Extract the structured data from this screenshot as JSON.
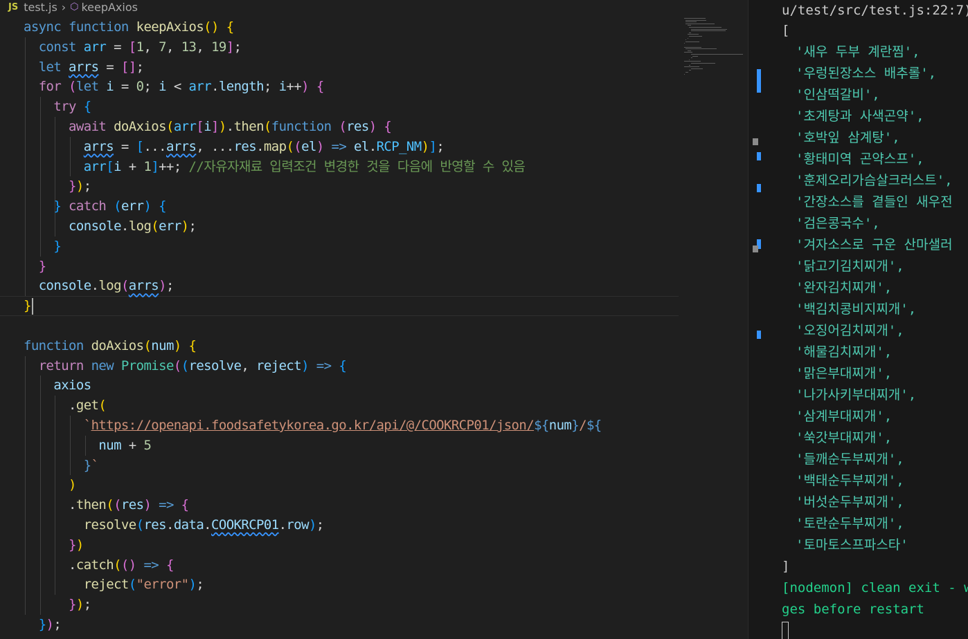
{
  "breadcrumb": {
    "lang_badge": "JS",
    "file": "test.js",
    "symbol": "keepAxios"
  },
  "icons": {
    "breadcrumb_separator": "chevron-right-icon",
    "symbol_icon": "cube-icon"
  },
  "colors": {
    "editor_bg": "#1f1f1f",
    "terminal_bg": "#181818",
    "keyword": "#569cd6",
    "control": "#c586c0",
    "function": "#dcdcaa",
    "variable": "#9cdcfe",
    "string": "#ce9178",
    "comment": "#6a9955",
    "terminal_string": "#4ec9b0",
    "terminal_status": "#23d18b"
  },
  "code": {
    "lines": [
      [
        [
          "kw",
          "async "
        ],
        [
          "kw",
          "function "
        ],
        [
          "fn",
          "keepAxios"
        ],
        [
          "b1",
          "()"
        ],
        [
          "pun",
          " "
        ],
        [
          "b1",
          "{"
        ]
      ],
      [
        [
          "pun",
          "  "
        ],
        [
          "kw",
          "const "
        ],
        [
          "cst",
          "arr"
        ],
        [
          "pun",
          " = "
        ],
        [
          "b2",
          "["
        ],
        [
          "num",
          "1"
        ],
        [
          "pun",
          ", "
        ],
        [
          "num",
          "7"
        ],
        [
          "pun",
          ", "
        ],
        [
          "num",
          "13"
        ],
        [
          "pun",
          ", "
        ],
        [
          "num",
          "19"
        ],
        [
          "b2",
          "]"
        ],
        [
          "pun",
          ";"
        ]
      ],
      [
        [
          "pun",
          "  "
        ],
        [
          "kw",
          "let "
        ],
        [
          "var squig",
          "arrs"
        ],
        [
          "pun",
          " = "
        ],
        [
          "b2",
          "[]"
        ],
        [
          "pun",
          ";"
        ]
      ],
      [
        [
          "pun",
          "  "
        ],
        [
          "ctl",
          "for "
        ],
        [
          "b2",
          "("
        ],
        [
          "kw",
          "let "
        ],
        [
          "var",
          "i"
        ],
        [
          "pun",
          " = "
        ],
        [
          "num",
          "0"
        ],
        [
          "pun",
          "; "
        ],
        [
          "var",
          "i"
        ],
        [
          "pun",
          " < "
        ],
        [
          "cst",
          "arr"
        ],
        [
          "pun",
          "."
        ],
        [
          "var",
          "length"
        ],
        [
          "pun",
          "; "
        ],
        [
          "var",
          "i"
        ],
        [
          "pun",
          "++"
        ],
        [
          "b2",
          ")"
        ],
        [
          "pun",
          " "
        ],
        [
          "b2",
          "{"
        ]
      ],
      [
        [
          "pun",
          "    "
        ],
        [
          "ctl",
          "try "
        ],
        [
          "b3",
          "{"
        ]
      ],
      [
        [
          "pun",
          "      "
        ],
        [
          "ctl",
          "await "
        ],
        [
          "fn",
          "doAxios"
        ],
        [
          "b1",
          "("
        ],
        [
          "cst",
          "arr"
        ],
        [
          "b2",
          "["
        ],
        [
          "var",
          "i"
        ],
        [
          "b2",
          "]"
        ],
        [
          "b1",
          ")"
        ],
        [
          "pun",
          "."
        ],
        [
          "fn",
          "then"
        ],
        [
          "b1",
          "("
        ],
        [
          "kw",
          "function "
        ],
        [
          "b2",
          "("
        ],
        [
          "var",
          "res"
        ],
        [
          "b2",
          ")"
        ],
        [
          "pun",
          " "
        ],
        [
          "b2",
          "{"
        ]
      ],
      [
        [
          "pun",
          "        "
        ],
        [
          "var squig",
          "arrs"
        ],
        [
          "pun",
          " = "
        ],
        [
          "b3",
          "["
        ],
        [
          "pun",
          "..."
        ],
        [
          "var squig",
          "arrs"
        ],
        [
          "pun",
          ", ..."
        ],
        [
          "var",
          "res"
        ],
        [
          "pun",
          "."
        ],
        [
          "fn",
          "map"
        ],
        [
          "b1",
          "("
        ],
        [
          "b2",
          "("
        ],
        [
          "var",
          "el"
        ],
        [
          "b2",
          ")"
        ],
        [
          "pun",
          " "
        ],
        [
          "kw",
          "=>"
        ],
        [
          "pun",
          " "
        ],
        [
          "var",
          "el"
        ],
        [
          "pun",
          "."
        ],
        [
          "cst",
          "RCP_NM"
        ],
        [
          "b1",
          ")"
        ],
        [
          "b3",
          "]"
        ],
        [
          "pun",
          ";"
        ]
      ],
      [
        [
          "pun",
          "        "
        ],
        [
          "cst",
          "arr"
        ],
        [
          "b3",
          "["
        ],
        [
          "var",
          "i"
        ],
        [
          "pun",
          " + "
        ],
        [
          "num",
          "1"
        ],
        [
          "b3",
          "]"
        ],
        [
          "pun",
          "++; "
        ],
        [
          "cmt",
          "//자유자재료 입력조건 변경한 것을 다음에 반영할 수 있음"
        ]
      ],
      [
        [
          "pun",
          "      "
        ],
        [
          "b2",
          "}"
        ],
        [
          "b1",
          ")"
        ],
        [
          "pun",
          ";"
        ]
      ],
      [
        [
          "pun",
          "    "
        ],
        [
          "b3",
          "}"
        ],
        [
          "pun",
          " "
        ],
        [
          "ctl",
          "catch "
        ],
        [
          "b3",
          "("
        ],
        [
          "var",
          "err"
        ],
        [
          "b3",
          ")"
        ],
        [
          "pun",
          " "
        ],
        [
          "b3",
          "{"
        ]
      ],
      [
        [
          "pun",
          "      "
        ],
        [
          "var",
          "console"
        ],
        [
          "pun",
          "."
        ],
        [
          "fn",
          "log"
        ],
        [
          "b1",
          "("
        ],
        [
          "var",
          "err"
        ],
        [
          "b1",
          ")"
        ],
        [
          "pun",
          ";"
        ]
      ],
      [
        [
          "pun",
          "    "
        ],
        [
          "b3",
          "}"
        ]
      ],
      [
        [
          "pun",
          "  "
        ],
        [
          "b2",
          "}"
        ]
      ],
      [
        [
          "pun",
          "  "
        ],
        [
          "var",
          "console"
        ],
        [
          "pun",
          "."
        ],
        [
          "fn",
          "log"
        ],
        [
          "b2",
          "("
        ],
        [
          "var squig",
          "arrs"
        ],
        [
          "b2",
          ")"
        ],
        [
          "pun",
          ";"
        ]
      ],
      [
        [
          "b1",
          "}"
        ]
      ],
      [],
      [
        [
          "kw",
          "function "
        ],
        [
          "fn",
          "doAxios"
        ],
        [
          "b1",
          "("
        ],
        [
          "var",
          "num"
        ],
        [
          "b1",
          ")"
        ],
        [
          "pun",
          " "
        ],
        [
          "b1",
          "{"
        ]
      ],
      [
        [
          "pun",
          "  "
        ],
        [
          "ctl",
          "return "
        ],
        [
          "kw",
          "new "
        ],
        [
          "typ",
          "Promise"
        ],
        [
          "b2",
          "("
        ],
        [
          "b3",
          "("
        ],
        [
          "var",
          "resolve"
        ],
        [
          "pun",
          ", "
        ],
        [
          "var",
          "reject"
        ],
        [
          "b3",
          ")"
        ],
        [
          "pun",
          " "
        ],
        [
          "kw",
          "=>"
        ],
        [
          "pun",
          " "
        ],
        [
          "b3",
          "{"
        ]
      ],
      [
        [
          "pun",
          "    "
        ],
        [
          "var",
          "axios"
        ]
      ],
      [
        [
          "pun",
          "      ."
        ],
        [
          "fn",
          "get"
        ],
        [
          "b1",
          "("
        ]
      ],
      [
        [
          "pun",
          "        "
        ],
        [
          "str",
          "`"
        ],
        [
          "url",
          "https://openapi.foodsafetykorea.go.kr/api/@/COOKRCP01/json/"
        ],
        [
          "kw",
          "${"
        ],
        [
          "var",
          "num"
        ],
        [
          "kw",
          "}"
        ],
        [
          "str",
          "/"
        ],
        [
          "kw",
          "${"
        ]
      ],
      [
        [
          "pun",
          "          "
        ],
        [
          "var",
          "num"
        ],
        [
          "pun",
          " + "
        ],
        [
          "num",
          "5"
        ]
      ],
      [
        [
          "pun",
          "        "
        ],
        [
          "kw",
          "}"
        ],
        [
          "str",
          "`"
        ]
      ],
      [
        [
          "pun",
          "      "
        ],
        [
          "b1",
          ")"
        ]
      ],
      [
        [
          "pun",
          "      ."
        ],
        [
          "fn",
          "then"
        ],
        [
          "b1",
          "("
        ],
        [
          "b2",
          "("
        ],
        [
          "var",
          "res"
        ],
        [
          "b2",
          ")"
        ],
        [
          "pun",
          " "
        ],
        [
          "kw",
          "=>"
        ],
        [
          "pun",
          " "
        ],
        [
          "b2",
          "{"
        ]
      ],
      [
        [
          "pun",
          "        "
        ],
        [
          "fn",
          "resolve"
        ],
        [
          "b3",
          "("
        ],
        [
          "var",
          "res"
        ],
        [
          "pun",
          "."
        ],
        [
          "var",
          "data"
        ],
        [
          "pun",
          "."
        ],
        [
          "var squig",
          "COOKRCP01"
        ],
        [
          "pun",
          "."
        ],
        [
          "var",
          "row"
        ],
        [
          "b3",
          ")"
        ],
        [
          "pun",
          ";"
        ]
      ],
      [
        [
          "pun",
          "      "
        ],
        [
          "b2",
          "}"
        ],
        [
          "b1",
          ")"
        ]
      ],
      [
        [
          "pun",
          "      ."
        ],
        [
          "fn",
          "catch"
        ],
        [
          "b1",
          "("
        ],
        [
          "b2",
          "()"
        ],
        [
          "pun",
          " "
        ],
        [
          "kw",
          "=>"
        ],
        [
          "pun",
          " "
        ],
        [
          "b2",
          "{"
        ]
      ],
      [
        [
          "pun",
          "        "
        ],
        [
          "fn",
          "reject"
        ],
        [
          "b3",
          "("
        ],
        [
          "str",
          "\"error\""
        ],
        [
          "b3",
          ")"
        ],
        [
          "pun",
          ";"
        ]
      ],
      [
        [
          "pun",
          "      "
        ],
        [
          "b2",
          "}"
        ],
        [
          "b1",
          ")"
        ],
        [
          "pun",
          ";"
        ]
      ],
      [
        [
          "pun",
          "  "
        ],
        [
          "b3",
          "}"
        ],
        [
          "b2",
          ")"
        ],
        [
          "pun",
          ";"
        ]
      ],
      [
        [
          "b1",
          "}"
        ]
      ]
    ]
  },
  "terminal": {
    "header": "u/test/src/test.js:22:7)",
    "open_bracket": "[",
    "items": [
      "'새우 두부 계란찜',",
      "'우렁된장소스 배추롤',",
      "'인삼떡갈비',",
      "'초계탕과 사색곤약',",
      "'호박잎 삼계탕',",
      "'황태미역 곤약스프',",
      "'훈제오리가슴살크러스트',",
      "'간장소스를 곁들인 새우전",
      "'검은콩국수',",
      "'겨자소스로 구운 산마샐러",
      "'닭고기김치찌개',",
      "'완자김치찌개',",
      "'백김치콩비지찌개',",
      "'오징어김치찌개',",
      "'해물김치찌개',",
      "'맑은부대찌개',",
      "'나가사키부대찌개',",
      "'삼계부대찌개',",
      "'쑥갓부대찌개',",
      "'들깨순두부찌개',",
      "'백태순두부찌개',",
      "'버섯순두부찌개',",
      "'토란순두부찌개',",
      "'토마토스프파스타'"
    ],
    "close_bracket": "]",
    "status_line1": "[nodemon] clean exit - wait",
    "status_line2": "ges before restart"
  }
}
